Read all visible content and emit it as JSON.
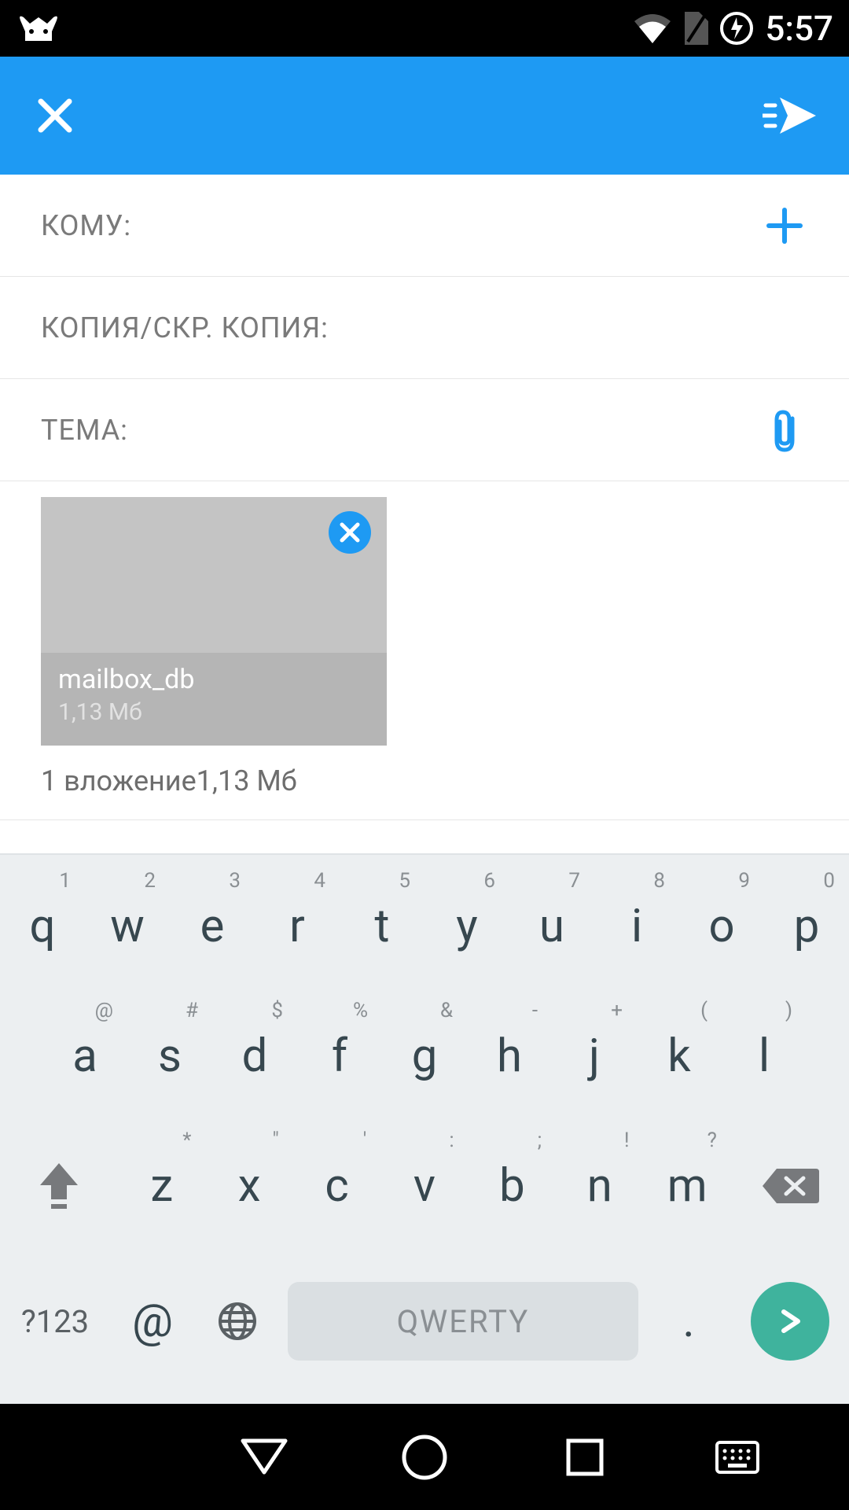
{
  "status": {
    "time": "5:57"
  },
  "compose": {
    "to_label": "КОМУ:",
    "cc_label": "КОПИЯ/СКР. КОПИЯ:",
    "subject_label": "ТЕМА:"
  },
  "attachment": {
    "name": "mailbox_db",
    "size": "1,13  Мб",
    "summary": "1 вложение1,13  Мб"
  },
  "keyboard": {
    "row1": [
      {
        "k": "q",
        "h": "1"
      },
      {
        "k": "w",
        "h": "2"
      },
      {
        "k": "e",
        "h": "3"
      },
      {
        "k": "r",
        "h": "4"
      },
      {
        "k": "t",
        "h": "5"
      },
      {
        "k": "y",
        "h": "6"
      },
      {
        "k": "u",
        "h": "7"
      },
      {
        "k": "i",
        "h": "8"
      },
      {
        "k": "o",
        "h": "9"
      },
      {
        "k": "p",
        "h": "0"
      }
    ],
    "row2": [
      {
        "k": "a",
        "h": "@"
      },
      {
        "k": "s",
        "h": "#"
      },
      {
        "k": "d",
        "h": "$"
      },
      {
        "k": "f",
        "h": "%"
      },
      {
        "k": "g",
        "h": "&"
      },
      {
        "k": "h",
        "h": "-"
      },
      {
        "k": "j",
        "h": "+"
      },
      {
        "k": "k",
        "h": "("
      },
      {
        "k": "l",
        "h": ")"
      }
    ],
    "row3": [
      {
        "k": "z",
        "h": "*"
      },
      {
        "k": "x",
        "h": "\""
      },
      {
        "k": "c",
        "h": "'"
      },
      {
        "k": "v",
        "h": ":"
      },
      {
        "k": "b",
        "h": ";"
      },
      {
        "k": "n",
        "h": "!"
      },
      {
        "k": "m",
        "h": "?"
      }
    ],
    "sym": "?123",
    "at": "@",
    "space_label": "QWERTY",
    "dot": "."
  }
}
